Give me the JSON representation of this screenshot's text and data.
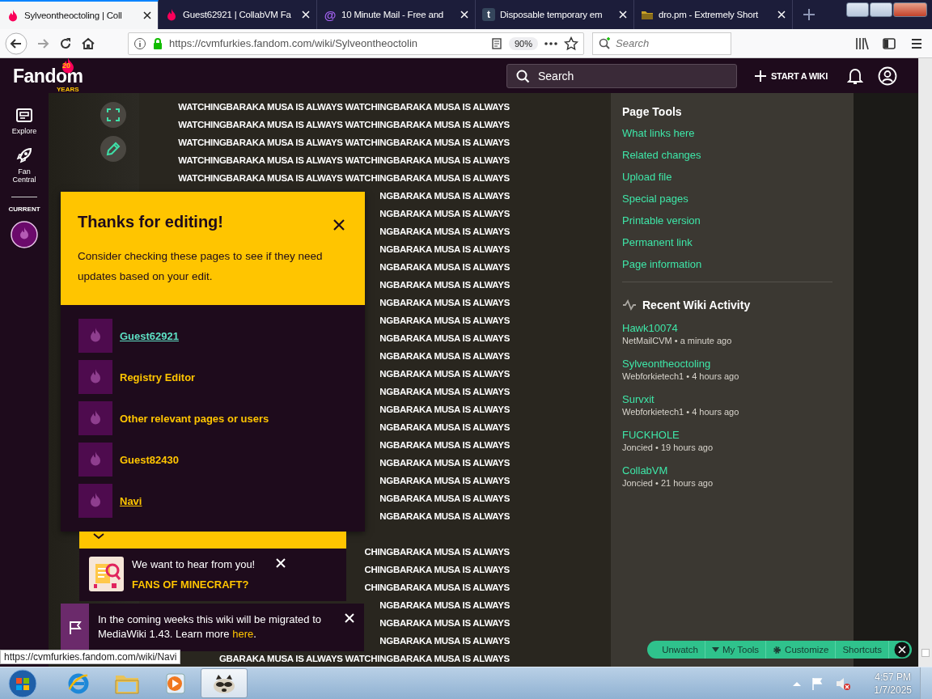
{
  "browser": {
    "tabs": [
      {
        "kind": "flame",
        "title": "Sylveontheoctoling | Coll",
        "selected": true
      },
      {
        "kind": "flame",
        "title": "Guest62921 | CollabVM Fa",
        "selected": false
      },
      {
        "kind": "glyph",
        "favicon_text": "@",
        "title": "10 Minute Mail - Free and",
        "selected": false
      },
      {
        "kind": "glyph",
        "favicon_text": "t",
        "title": "Disposable temporary em",
        "selected": false
      },
      {
        "kind": "folder",
        "title": "dro.pm - Extremely Short",
        "selected": false
      }
    ],
    "address": "https://cvmfurkies.fandom.com/wiki/Sylveontheoctolin",
    "zoom": "90%",
    "search": {
      "placeholder": "Search"
    },
    "status_url": "https://cvmfurkies.fandom.com/wiki/Navi"
  },
  "header": {
    "logo": "Fandom",
    "logo_badge": "20",
    "logo_caption": "YEARS",
    "search": {
      "placeholder": "Search"
    },
    "start_wiki": "START A WIKI"
  },
  "rail": {
    "items": [
      {
        "kind": "explore",
        "label": "Explore"
      },
      {
        "kind": "rocket",
        "label": "Fan Central"
      }
    ],
    "current_label": "CURRENT"
  },
  "article": {
    "blocks": [
      [
        "WATCHINGBARAKA MUSA IS ALWAYS WATCHINGBARAKA MUSA IS ALWAYS",
        "WATCHINGBARAKA MUSA IS ALWAYS WATCHINGBARAKA MUSA IS ALWAYS",
        "WATCHINGBARAKA MUSA IS ALWAYS WATCHINGBARAKA MUSA IS ALWAYS",
        "WATCHINGBARAKA MUSA IS ALWAYS WATCHINGBARAKA MUSA IS ALWAYS",
        "WATCHINGBARAKA MUSA IS ALWAYS WATCHINGBARAKA MUSA IS ALWAYS",
        "NGBARAKA MUSA IS ALWAYS",
        "NGBARAKA MUSA IS ALWAYS",
        "NGBARAKA MUSA IS ALWAYS",
        "NGBARAKA MUSA IS ALWAYS",
        "NGBARAKA MUSA IS ALWAYS",
        "NGBARAKA MUSA IS ALWAYS",
        "NGBARAKA MUSA IS ALWAYS",
        "NGBARAKA MUSA IS ALWAYS",
        "NGBARAKA MUSA IS ALWAYS",
        "NGBARAKA MUSA IS ALWAYS",
        "NGBARAKA MUSA IS ALWAYS",
        "NGBARAKA MUSA IS ALWAYS",
        "NGBARAKA MUSA IS ALWAYS",
        "NGBARAKA MUSA IS ALWAYS",
        "NGBARAKA MUSA IS ALWAYS",
        "NGBARAKA MUSA IS ALWAYS",
        "NGBARAKA MUSA IS ALWAYS",
        "NGBARAKA MUSA IS ALWAYS",
        "NGBARAKA MUSA IS ALWAYS"
      ],
      [
        "CHINGBARAKA MUSA IS ALWAYS",
        "CHINGBARAKA MUSA IS ALWAYS",
        "CHINGBARAKA MUSA IS ALWAYS",
        "NGBARAKA MUSA IS ALWAYS",
        "NGBARAKA MUSA IS ALWAYS",
        "NGBARAKA MUSA IS ALWAYS",
        "GBARAKA MUSA IS ALWAYS WATCHINGBARAKA MUSA IS ALWAYS"
      ]
    ]
  },
  "thanks_popup": {
    "title": "Thanks for editing!",
    "text": "Consider checking these pages to see if they need updates based on your edit.",
    "links": [
      {
        "label": "Guest62921",
        "color": "#5ee0c4",
        "underlined": true
      },
      {
        "label": "Registry Editor",
        "color": "#ffc500",
        "underlined": false
      },
      {
        "label": "Other relevant pages or users",
        "color": "#ffc500",
        "underlined": false
      },
      {
        "label": "Guest82430",
        "color": "#ffc500",
        "underlined": false
      },
      {
        "label": "Navi",
        "color": "#ffc500",
        "underlined": true
      }
    ]
  },
  "feedback": {
    "title": "We want to hear from you!",
    "question": "FANS OF MINECRAFT?"
  },
  "notice": {
    "text_before": "In the coming weeks this wiki will be migrated to MediaWiki 1.43. Learn more ",
    "link": "here",
    "text_after": "."
  },
  "page_tools": {
    "title": "Page Tools",
    "links": [
      "What links here",
      "Related changes",
      "Upload file",
      "Special pages",
      "Printable version",
      "Permanent link",
      "Page information"
    ]
  },
  "recent_activity": {
    "title": "Recent Wiki Activity",
    "items": [
      {
        "page": "Hawk10074",
        "meta": "NetMailCVM • a minute ago"
      },
      {
        "page": "Sylveontheoctoling",
        "meta": "Webforkietech1 • 4 hours ago"
      },
      {
        "page": "Survxit",
        "meta": "Webforkietech1 • 4 hours ago"
      },
      {
        "page": "FUCKHOLE",
        "meta": "Joncied • 19 hours ago"
      },
      {
        "page": "CollabVM",
        "meta": "Joncied • 21 hours ago"
      }
    ]
  },
  "toolbar": {
    "items": [
      {
        "label": "Unwatch",
        "kind": "plain"
      },
      {
        "label": "My Tools",
        "kind": "menu"
      },
      {
        "label": "Customize",
        "kind": "settings"
      },
      {
        "label": "Shortcuts",
        "kind": "plain"
      }
    ]
  },
  "taskbar": {
    "apps": [
      {
        "kind": "browser",
        "active": false
      },
      {
        "kind": "files",
        "active": false
      },
      {
        "kind": "player",
        "active": false
      },
      {
        "kind": "raccoon",
        "active": true
      }
    ],
    "time": "4:57 PM",
    "date": "1/7/2025"
  }
}
